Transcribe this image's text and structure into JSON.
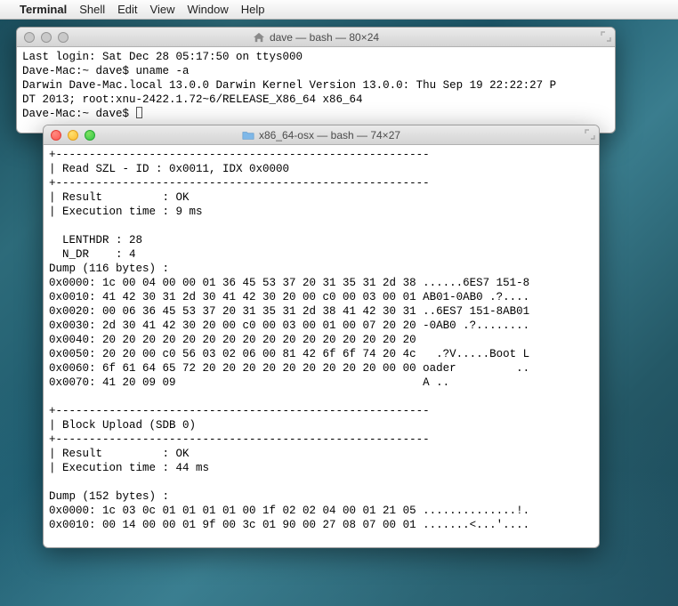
{
  "menubar": {
    "apple": "",
    "app": "Terminal",
    "items": [
      "Shell",
      "Edit",
      "View",
      "Window",
      "Help"
    ]
  },
  "win1": {
    "title": "dave — bash — 80×24",
    "lines": [
      "Last login: Sat Dec 28 05:17:50 on ttys000",
      "Dave-Mac:~ dave$ uname -a",
      "Darwin Dave-Mac.local 13.0.0 Darwin Kernel Version 13.0.0: Thu Sep 19 22:22:27 P",
      "DT 2013; root:xnu-2422.1.72~6/RELEASE_X86_64 x86_64",
      "Dave-Mac:~ dave$ "
    ]
  },
  "win2": {
    "title": "x86_64-osx — bash — 74×27",
    "lines": [
      "+--------------------------------------------------------",
      "| Read SZL - ID : 0x0011, IDX 0x0000",
      "+--------------------------------------------------------",
      "| Result         : OK",
      "| Execution time : 9 ms",
      "",
      "  LENTHDR : 28",
      "  N_DR    : 4",
      "Dump (116 bytes) :",
      "0x0000: 1c 00 04 00 00 01 36 45 53 37 20 31 35 31 2d 38 ......6ES7 151-8",
      "0x0010: 41 42 30 31 2d 30 41 42 30 20 00 c0 00 03 00 01 AB01-0AB0 .?....",
      "0x0020: 00 06 36 45 53 37 20 31 35 31 2d 38 41 42 30 31 ..6ES7 151-8AB01",
      "0x0030: 2d 30 41 42 30 20 00 c0 00 03 00 01 00 07 20 20 -0AB0 .?........",
      "0x0040: 20 20 20 20 20 20 20 20 20 20 20 20 20 20 20 20",
      "0x0050: 20 20 00 c0 56 03 02 06 00 81 42 6f 6f 74 20 4c   .?V.....Boot L",
      "0x0060: 6f 61 64 65 72 20 20 20 20 20 20 20 20 20 00 00 oader         ..",
      "0x0070: 41 20 09 09                                     A ..",
      "",
      "+--------------------------------------------------------",
      "| Block Upload (SDB 0)",
      "+--------------------------------------------------------",
      "| Result         : OK",
      "| Execution time : 44 ms",
      "",
      "Dump (152 bytes) :",
      "0x0000: 1c 03 0c 01 01 01 01 00 1f 02 02 04 00 01 21 05 ..............!.",
      "0x0010: 00 14 00 00 01 9f 00 3c 01 90 00 27 08 07 00 01 .......<...'...."
    ]
  }
}
